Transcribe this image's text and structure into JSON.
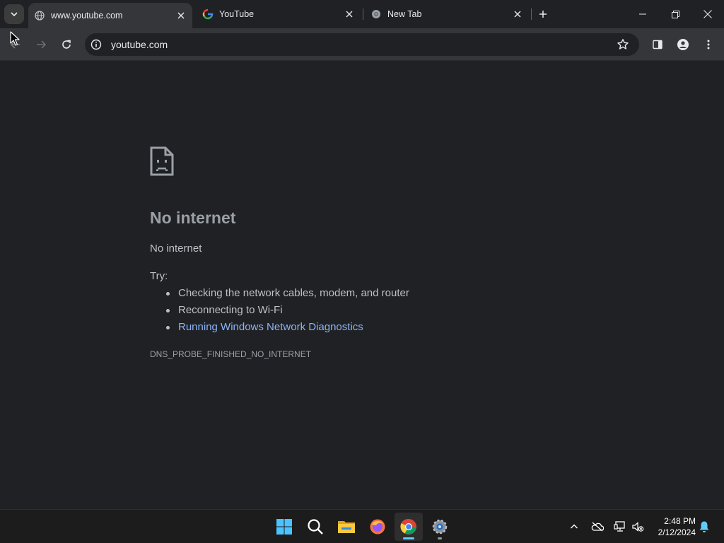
{
  "browser": {
    "tabs": [
      {
        "title": "www.youtube.com",
        "active": true,
        "favicon": "globe-icon"
      },
      {
        "title": "YouTube",
        "active": false,
        "favicon": "google-g-icon"
      },
      {
        "title": "New Tab",
        "active": false,
        "favicon": "chrome-icon"
      }
    ],
    "address": {
      "url": "youtube.com"
    }
  },
  "error_page": {
    "title": "No internet",
    "subtitle": "No internet",
    "try_label": "Try:",
    "suggestions": [
      "Checking the network cables, modem, and router",
      "Reconnecting to Wi-Fi",
      "Running Windows Network Diagnostics"
    ],
    "error_code": "DNS_PROBE_FINISHED_NO_INTERNET"
  },
  "taskbar": {
    "apps": [
      "start-icon",
      "search-icon",
      "file-explorer-icon",
      "firefox-icon",
      "chrome-icon",
      "settings-icon"
    ],
    "clock": {
      "time": "2:48 PM",
      "date": "2/12/2024"
    }
  },
  "colors": {
    "link": "#8ab4f8",
    "background": "#202124",
    "toolbar": "#35363a"
  }
}
